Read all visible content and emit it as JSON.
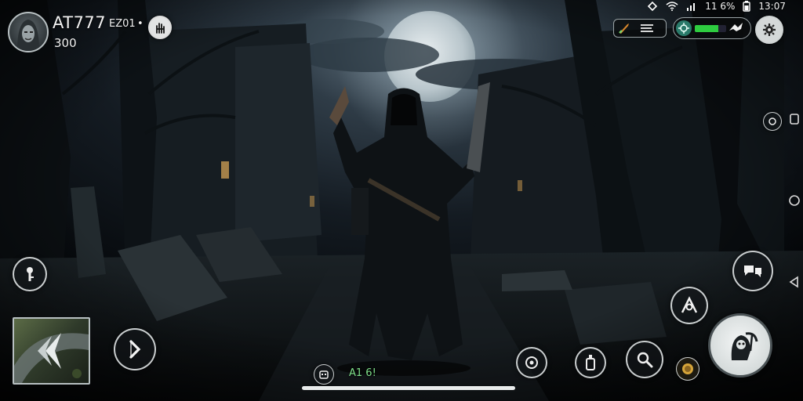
{
  "status_bar": {
    "battery": "11 6%",
    "time": "13:07"
  },
  "player": {
    "name": "AT777",
    "tag": "EZ01",
    "dot": "•",
    "score": "300",
    "avatar_icon": "hooded-face-icon"
  },
  "hud": {
    "health_fraction": 0.75,
    "health_color": "#2ecc40"
  },
  "bottom": {
    "ammo_label": "A1 6!"
  },
  "icons": {
    "top_left_action": "hand-icon",
    "weapon_slot": "knife-icon",
    "menu": "menu-icon",
    "target": "crosshair-icon",
    "wing": "wing-icon",
    "settings": "gear-icon",
    "side_small": "circle-icon",
    "left_item": "key-icon",
    "dodge": "arrow-right-icon",
    "chat": "chat-icon",
    "special": "claw-icon",
    "attack": "reaper-icon",
    "bottom_1": "target-icon",
    "bottom_2": "bottle-icon",
    "bottom_3": "search-icon",
    "bottom_4": "coin-icon",
    "bottom_small": "mask-icon"
  }
}
